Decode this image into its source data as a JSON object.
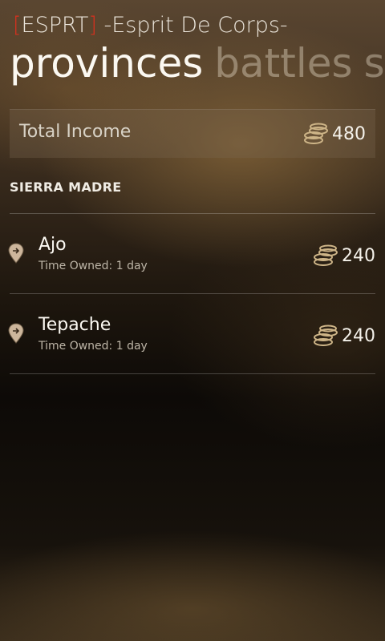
{
  "app": {
    "bracket_open": "[",
    "clan_tag": "ESPRT",
    "bracket_close": "]",
    "clan_name": " -Esprit De Corps-"
  },
  "pivot": {
    "tabs": [
      "provinces",
      "battles",
      "s"
    ],
    "active_index": 0
  },
  "summary": {
    "total_label": "Total Income",
    "total_value": "480",
    "coin_icon": "coin-stack-icon"
  },
  "region": {
    "name": "SIERRA MADRE"
  },
  "provinces": [
    {
      "name": "Ajo",
      "time_owned": "Time Owned: 1 day",
      "income": "240",
      "icon": "map-pin-icon"
    },
    {
      "name": "Tepache",
      "time_owned": "Time Owned: 1 day",
      "income": "240",
      "icon": "map-pin-icon"
    }
  ],
  "colors": {
    "accent_red": "#d4311f",
    "coin": "#cdb487",
    "text": "#f2efe8"
  }
}
